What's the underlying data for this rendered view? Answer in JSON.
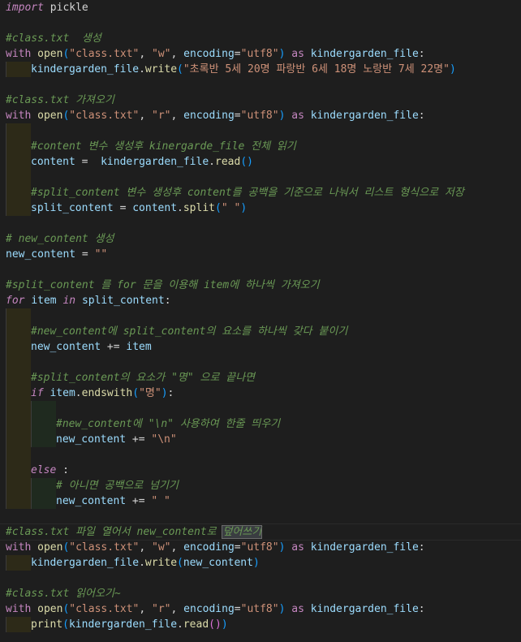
{
  "tokens": {
    "import": "import",
    "pickle": " pickle",
    "with": "with",
    "open": "open",
    "lp": "(",
    "rp": ")",
    "class_txt": "\"class.txt\"",
    "comma": ", ",
    "w_str": "\"w\"",
    "r_str": "\"r\"",
    "encoding": "encoding",
    "eq": "=",
    "utf8": "\"utf8\"",
    "as": " as ",
    "kg_file": "kindergarden_file",
    "colon": ":",
    "dot": ".",
    "write": "write",
    "read": "read",
    "content": "content",
    "assign": " = ",
    "assign2": " =  ",
    "split_content": "split_content",
    "split": "split",
    "space_str": "\" \"",
    "new_content": "new_content",
    "empty_str": "\"\"",
    "for": "for",
    "item": "item",
    "in": " in ",
    "plus_eq": " += ",
    "if": "if",
    "endswith": "endswith",
    "myeong_str": "\"명\"",
    "newline_str": "\"\\n\"",
    "else": "else",
    "else_colon": " :",
    "print": "print",
    "sp": " "
  },
  "strings": {
    "class_write": "\"초록반 5세 20명 파랑반 6세 18명 노랑반 7세 22명\""
  },
  "comments": {
    "c1": "#class.txt  생성",
    "c2": "#class.txt 가져오기",
    "c3": "#content 변수 생성후 kinergarde_file 전체 읽기",
    "c4": "#split_content 변수 생성후 content를 공백을 기준으로 나눠서 리스트 형식으로 저장",
    "c5": "# new_content 생성",
    "c6": "#split_content 를 for 문을 이용해 item에 하나씩 가져오기",
    "c7": "#new_content에 split_content의 요소를 하나씩 갖다 붙이기",
    "c8": "#split_content의 요소가 \"명\" 으로 끝나면",
    "c9": "#new_content에 \"\\n\" 사용하여 한줄 띄우기",
    "c10": "# 아니면 공백으로 넘기기",
    "c11a": "#class.txt 파일 열어서 new_content로 ",
    "c11b": "덮어쓰기",
    "c12": "#class.txt 읽어오기~"
  }
}
